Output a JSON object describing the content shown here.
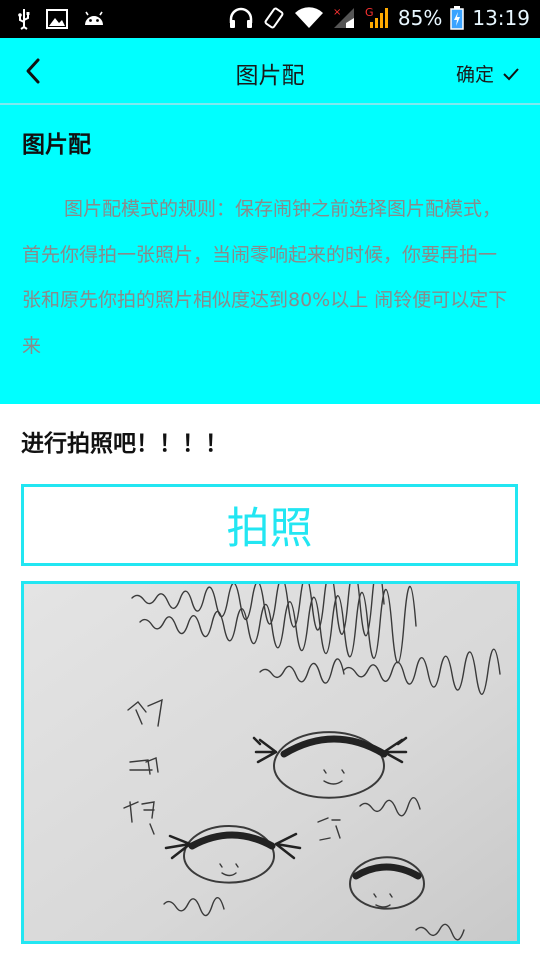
{
  "status_bar": {
    "battery": "85%",
    "time": "13:19",
    "network_badge": "G",
    "icons": [
      "usb-icon",
      "image-icon",
      "android-icon",
      "headphones-icon",
      "rotate-icon",
      "wifi-icon",
      "signal-icon",
      "signal-icon",
      "battery-icon"
    ]
  },
  "app_bar": {
    "back_icon": "chevron-left-icon",
    "title": "图片配",
    "confirm_label": "确定",
    "confirm_icon": "check-icon"
  },
  "rule": {
    "heading": "图片配",
    "text": "图片配模式的规则：保存闹钟之前选择图片配模式，首先你得拍一张照片，当闹零响起来的时候，你要再拍一张和原先你拍的照片相似度达到80%以上 闹铃便可以定下来"
  },
  "content": {
    "prompt": "进行拍照吧！！！！",
    "photo_button_label": "拍照",
    "photo_alt": "photo-of-hand-drawn-sketch"
  },
  "colors": {
    "accent": "#00ffff",
    "border": "#22e6f2",
    "status_bar": "#000000"
  }
}
